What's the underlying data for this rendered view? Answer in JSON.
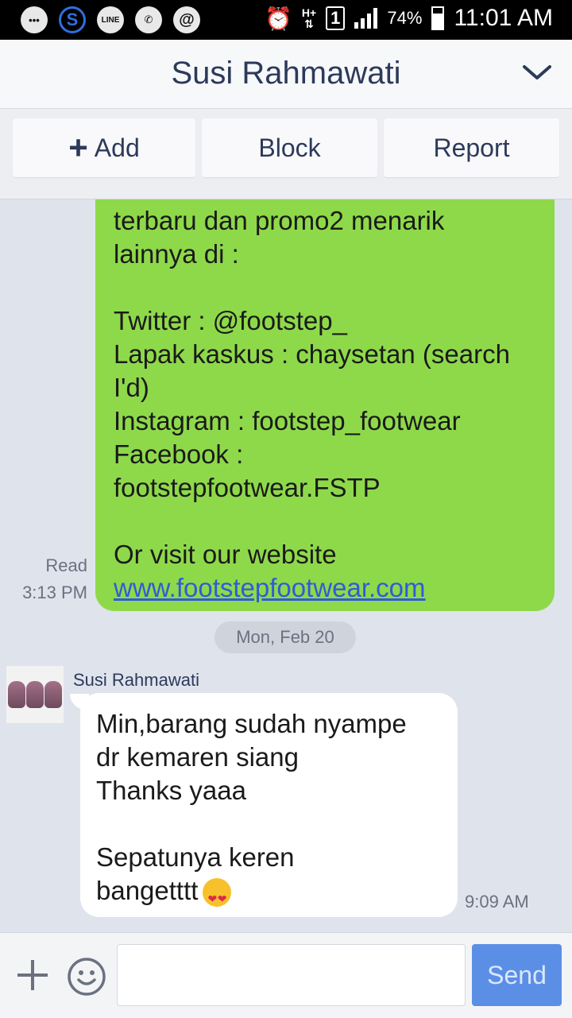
{
  "status_bar": {
    "app_icons": [
      "more-icon",
      "s-icon",
      "line-icon",
      "whatsapp-icon",
      "at-icon"
    ],
    "line_label": "LINE",
    "network": "H+",
    "sim_slot": "1",
    "battery_percent": "74%",
    "time": "11:01 AM"
  },
  "header": {
    "title": "Susi Rahmawati"
  },
  "actions": {
    "add_label": "Add",
    "block_label": "Block",
    "report_label": "Report"
  },
  "messages": {
    "outgoing": {
      "lines": [
        "terbaru dan promo2 menarik",
        "lainnya di :",
        "",
        "Twitter : @footstep_",
        "Lapak kaskus : chaysetan (search",
        "I'd)",
        "Instagram : footstep_footwear",
        "Facebook :",
        "footstepfootwear.FSTP",
        "",
        "Or visit our website"
      ],
      "link": "www.footstepfootwear.com",
      "read_label": "Read",
      "time": "3:13 PM"
    },
    "date_separator": "Mon, Feb 20",
    "incoming": {
      "sender": "Susi Rahmawati",
      "lines": [
        "Min,barang sudah nyampe",
        "dr kemaren siang",
        "Thanks yaaa",
        "",
        "Sepatunya keren"
      ],
      "last_line": "bangetttt",
      "emoji": "heart-eyes-emoji",
      "time": "9:09 AM"
    }
  },
  "input_bar": {
    "placeholder": "",
    "send_label": "Send"
  }
}
